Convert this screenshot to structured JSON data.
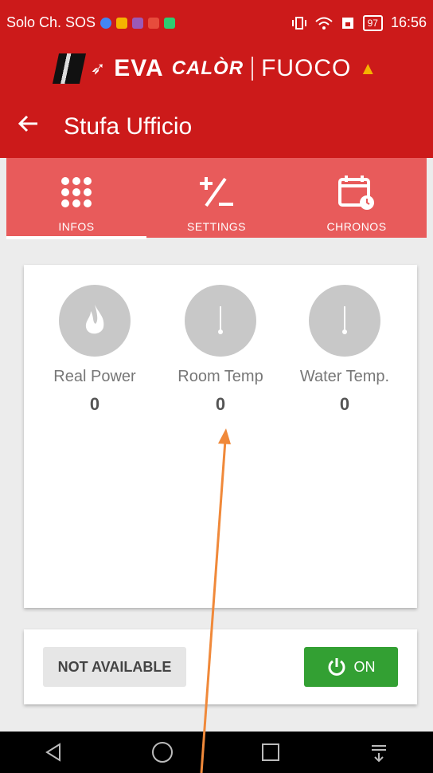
{
  "status_bar": {
    "carrier": "Solo Ch. SOS",
    "battery": "97",
    "time": "16:56"
  },
  "logo": {
    "eva": "EVA",
    "calor": "CALÒR",
    "fuoco": "FUOCO"
  },
  "header": {
    "title": "Stufa Ufficio",
    "back_icon": "arrow-left-icon"
  },
  "tabs": [
    {
      "label": "INFOS",
      "icon": "grid-dots-icon",
      "active": true
    },
    {
      "label": "SETTINGS",
      "icon": "plus-minus-icon",
      "active": false
    },
    {
      "label": "CHRONOS",
      "icon": "calendar-clock-icon",
      "active": false
    }
  ],
  "infos": [
    {
      "name": "Real Power",
      "value": "0",
      "icon": "flame-icon"
    },
    {
      "name": "Room Temp",
      "value": "0",
      "icon": "thermometer-icon"
    },
    {
      "name": "Water Temp.",
      "value": "0",
      "icon": "thermometer-icon"
    }
  ],
  "controls": {
    "status_label": "NOT AVAILABLE",
    "on_label": "ON"
  },
  "colors": {
    "header_red": "#cc1a1a",
    "tab_red": "#e85b5b",
    "on_green": "#33a033",
    "annotation_arrow": "#f0893a"
  }
}
